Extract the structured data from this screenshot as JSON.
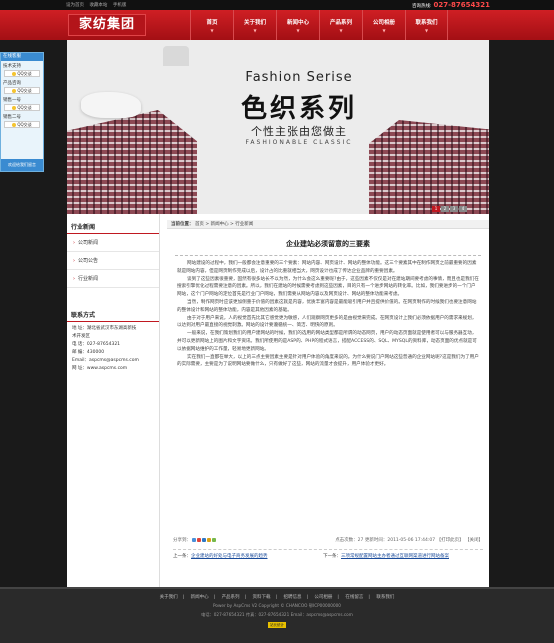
{
  "topbar": {
    "links": [
      "设为首页",
      "收藏本站",
      "手机版"
    ],
    "hotline_label": "咨询热线:",
    "hotline_number": "027-87654321"
  },
  "logo": {
    "text": "家纺集团"
  },
  "nav": [
    {
      "label": "首页"
    },
    {
      "label": "关于我们"
    },
    {
      "label": "新闻中心"
    },
    {
      "label": "产品系列"
    },
    {
      "label": "公司相册"
    },
    {
      "label": "联系我们"
    }
  ],
  "banner": {
    "fashion": "Fashion Serise",
    "title": "色织系列",
    "sub1": "个性主张由您做主",
    "sub2": "FASHIONABLE CLASSIC",
    "pages": [
      "1",
      "2",
      "3",
      "4"
    ]
  },
  "qq": {
    "head": "在线客服",
    "groups": [
      {
        "name": "技术支持",
        "btn": "QQ交谈"
      },
      {
        "name": "产品咨询",
        "btn": "QQ交谈"
      },
      {
        "name": "销售一号",
        "btn": "QQ交谈"
      },
      {
        "name": "销售二号",
        "btn": "QQ交谈"
      }
    ],
    "foot": "欢迎给我们留言"
  },
  "sidebar": {
    "news_title": "行业新闻",
    "items": [
      "公司新闻",
      "公司公告",
      "行业新闻"
    ],
    "contact_title": "联系方式",
    "contact_lines": [
      "地  址：湖北省武汉市东湖高新技",
      "术开发区",
      "电  话：027-87654321",
      "邮  编：430000",
      "Email：aspcms@aspcms.com",
      "网  址：www.aspcms.com"
    ]
  },
  "article": {
    "crumb_label": "当前位置：",
    "crumb": [
      "首页",
      "新闻中心",
      "行业新闻"
    ],
    "title": "企业建站必须留意的三要素",
    "paragraphs": [
      "网站建设的过程中，我们一般都会注意重要的三个要素：网站内容、网页设计、网站的整体功能。这三个要素其中在制作网页之前最重要的因素就是网站内容，但是网页制作完成以后，设计占的比重就相当大，网页设计也成了传达企业品牌的重要因素。",
      "谈到了这些因素很重要，固然有很多站长不以为然，为什么会这么重要呢?由于，这些因素不仅仅是对在建站期间要考虑的事情，而且也是我们在搜索引擎优化过程需要注意的因素。所以，我们在建站的时候需要考虑到这些因素，目的只有一个进步网站的转化率。比如，我们要进步的一个门户网站，这个门户网站的定位首先是行业门户网站，我们需要从网站内容以及网页设计、网站的整体功能来考虑。",
      "当然，制作网页时应该更加侧重于价值的因素这就是内容，优质丰富内容是最能吸引用户并且提供价值的。在网页制作的时候我们也要注意网站的整体设计和网站的整体功能，内容是其他因素的基础。",
      "由于对于用户来说，人的视觉首先比其它感觉更为敏感，人们观察网页更多的是由视觉来完成。在网页设计上我们必须依据用户的需求来规划，以达到对用户最直接的视觉刺激。网站的设计要遵循统一、简洁、明快的原则。",
      "一般来说，在我们策划我们的用户建网站的时候，我们的选用的网站类型都是所谓的动态网页，用户的动态页面就是使用者可以与服务器互动，并可以更新网站上的图片和文字资讯。我们所使用的是ASP的、PHP的程式语言，搭配ACCESS的、SQL、MYSQL的资料库，动态页面的优点就是可以依据网站维护的工作量，轻易地更新网站。",
      "实在我们一直都在举大，以上的三点主要因素主要是针对用户体验的角度来说的。为什么要说门户网站这些普通的企业网站呢?这是我们为了用户的实际需要，主要是为了说明网站要做什么，只有做好了这些，网站的流量才会提升，用户体验才更好。"
    ],
    "share_label": "分享到：",
    "meta": "点击次数：27  更新时间：2011-05-06 17:44:07  【打印此页】  【关闭】",
    "prev_label": "上一条：",
    "prev_link": "企业建站的好处与电子商务发展的趋势",
    "next_label": "下一条：",
    "next_link": "三项常规配置网站主办者通过互联网渠道进行网站备案"
  },
  "footer": {
    "nav": [
      "关于我们",
      "新闻中心",
      "产品系列",
      "资料下载",
      "招聘信息",
      "公司相册",
      "在线留言",
      "联系我们"
    ],
    "powered": "Power by AspCms V2 Copyright © CHANCOO 鄂ICP00000000",
    "contact": "电话：027-87654321 传真：027-87654321 Email：aspcms@aspcms.com",
    "badge": "站长统计"
  }
}
